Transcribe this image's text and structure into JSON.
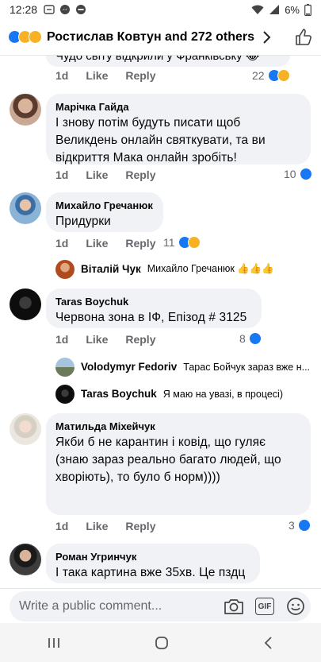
{
  "status": {
    "time": "12:28",
    "battery": "6%"
  },
  "header": {
    "title": "Ростислав Ковтун and 272 others"
  },
  "comments": [
    {
      "time": "1d",
      "like": "Like",
      "reply": "Reply",
      "reactions": "22"
    },
    {
      "name": "Марічка Гайда",
      "text": "І знову потім будуть писати щоб Великдень онлайн святкувати, та ви відкриття Мака онлайн зробіть!",
      "time": "1d",
      "like": "Like",
      "reply": "Reply",
      "reactions": "10"
    },
    {
      "name": "Михайло Гречанюк",
      "text": "Придурки",
      "time": "1d",
      "like": "Like",
      "reply": "Reply",
      "reactions": "11"
    },
    {
      "name": "Taras Boychuk",
      "text": "Червона зона в ІФ, Епізод # 3125",
      "time": "1d",
      "like": "Like",
      "reply": "Reply",
      "reactions": "8"
    },
    {
      "name": "Матильда Міхейчук",
      "text": "Якби б не карантин і ковід, що гуляє (знаю зараз реально  багато людей, що хворіють), то було б норм))))",
      "time": "1d",
      "like": "Like",
      "reply": "Reply",
      "reactions": "3"
    },
    {
      "name": "Роман Угринчук",
      "text": "І така картина вже 35хв. Це пздц"
    }
  ],
  "replies": [
    {
      "name": "Віталій Чук",
      "text": "Михайло Гречанюк 👍👍👍"
    },
    {
      "name": "Volodymyr Fedoriv",
      "text": "Тарас Бойчук зараз вже н..."
    },
    {
      "name": "Taras Boychuk",
      "text": "Я маю на увазі, в процесі)"
    }
  ],
  "composer": {
    "placeholder": "Write a public comment...",
    "gif": "GIF"
  },
  "partial_top_text": "Чудо світу відкрили у Франківську 😂"
}
